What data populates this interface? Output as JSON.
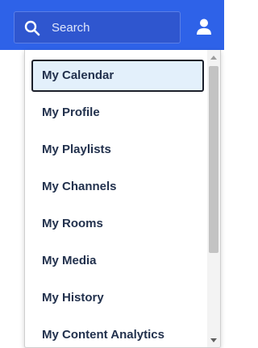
{
  "header": {
    "search": {
      "placeholder": "Search",
      "value": ""
    },
    "user_icon": "user-icon",
    "search_icon": "search-icon"
  },
  "menu": {
    "items": [
      {
        "label": "My Calendar",
        "active": true
      },
      {
        "label": "My Profile",
        "active": false
      },
      {
        "label": "My Playlists",
        "active": false
      },
      {
        "label": "My Channels",
        "active": false
      },
      {
        "label": "My Rooms",
        "active": false
      },
      {
        "label": "My Media",
        "active": false
      },
      {
        "label": "My History",
        "active": false
      },
      {
        "label": "My Content Analytics",
        "active": false
      }
    ]
  },
  "colors": {
    "header_bg": "#2e62e8",
    "search_bg": "#2f56cf",
    "active_item_bg": "#e3f0fb",
    "menu_text": "#22314d"
  }
}
